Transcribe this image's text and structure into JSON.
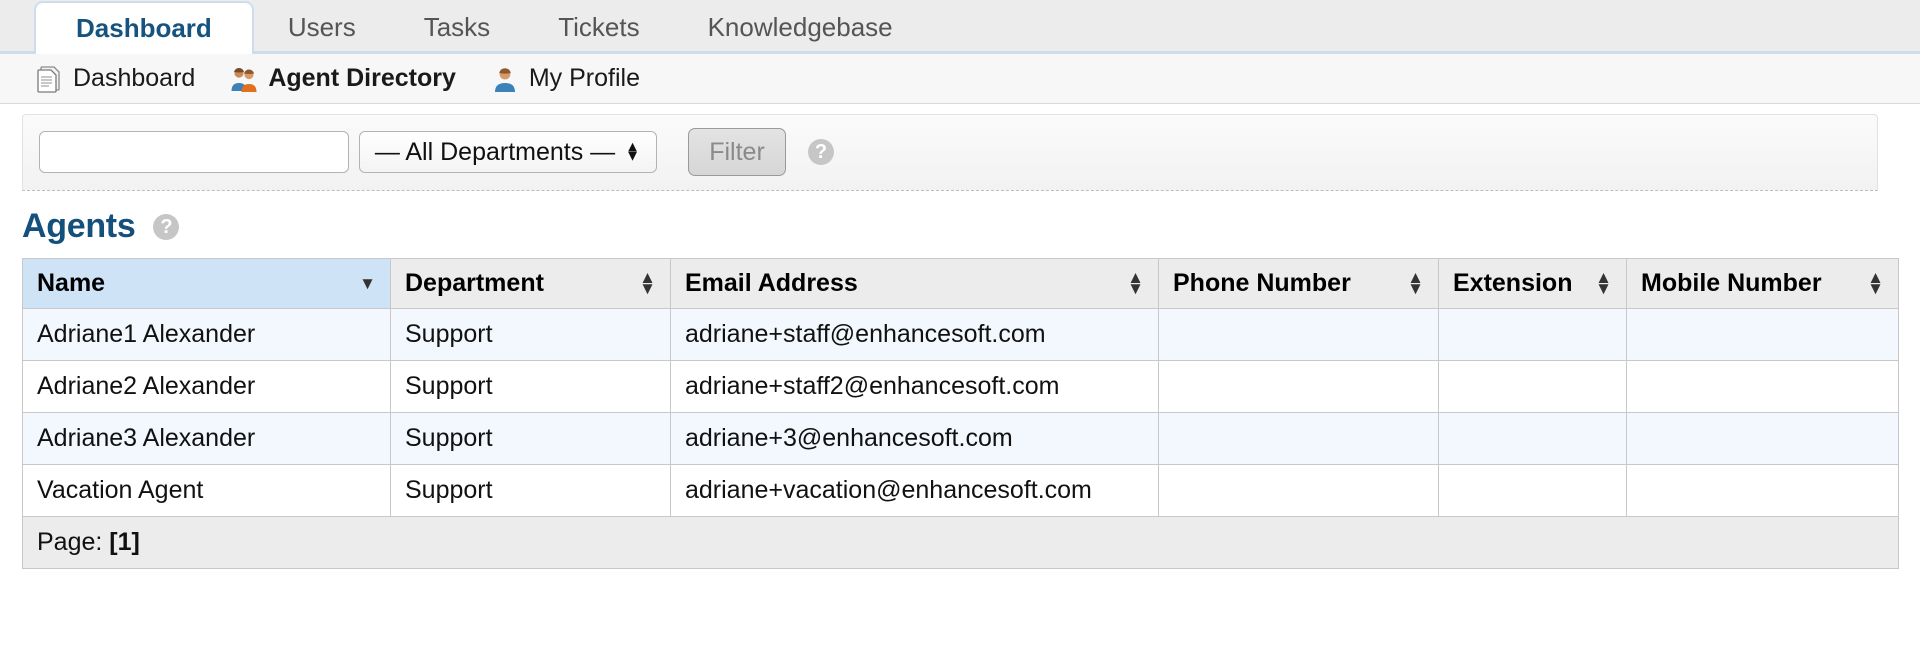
{
  "tabs": [
    {
      "label": "Dashboard",
      "active": true
    },
    {
      "label": "Users",
      "active": false
    },
    {
      "label": "Tasks",
      "active": false
    },
    {
      "label": "Tickets",
      "active": false
    },
    {
      "label": "Knowledgebase",
      "active": false
    }
  ],
  "subnav": [
    {
      "label": "Dashboard",
      "icon": "document-icon",
      "current": false
    },
    {
      "label": "Agent Directory",
      "icon": "two-users-icon",
      "current": true
    },
    {
      "label": "My Profile",
      "icon": "user-icon",
      "current": false
    }
  ],
  "filter": {
    "search_value": "",
    "search_placeholder": "",
    "department_selected": "— All Departments —",
    "button_label": "Filter",
    "help_icon": "question-mark-icon"
  },
  "section": {
    "title": "Agents",
    "help_icon": "question-mark-icon"
  },
  "table": {
    "columns": [
      {
        "label": "Name",
        "sort": "desc"
      },
      {
        "label": "Department",
        "sort": "none"
      },
      {
        "label": "Email Address",
        "sort": "none"
      },
      {
        "label": "Phone Number",
        "sort": "none"
      },
      {
        "label": "Extension",
        "sort": "none"
      },
      {
        "label": "Mobile Number",
        "sort": "none"
      }
    ],
    "rows": [
      [
        "Adriane1 Alexander",
        "Support",
        "adriane+staff@enhancesoft.com",
        "",
        "",
        ""
      ],
      [
        "Adriane2 Alexander",
        "Support",
        "adriane+staff2@enhancesoft.com",
        "",
        "",
        ""
      ],
      [
        "Adriane3 Alexander",
        "Support",
        "adriane+3@enhancesoft.com",
        "",
        "",
        ""
      ],
      [
        "Vacation Agent",
        "Support",
        "adriane+vacation@enhancesoft.com",
        "",
        "",
        ""
      ]
    ],
    "pager": {
      "label": "Page:",
      "pages": [
        "[1]"
      ]
    }
  },
  "colors": {
    "accent": "#14507c",
    "active_tab_text": "#17537f",
    "sorted_header": "#cfe3f7",
    "odd_row": "#f2f8fd",
    "header_bg": "#ececec"
  }
}
